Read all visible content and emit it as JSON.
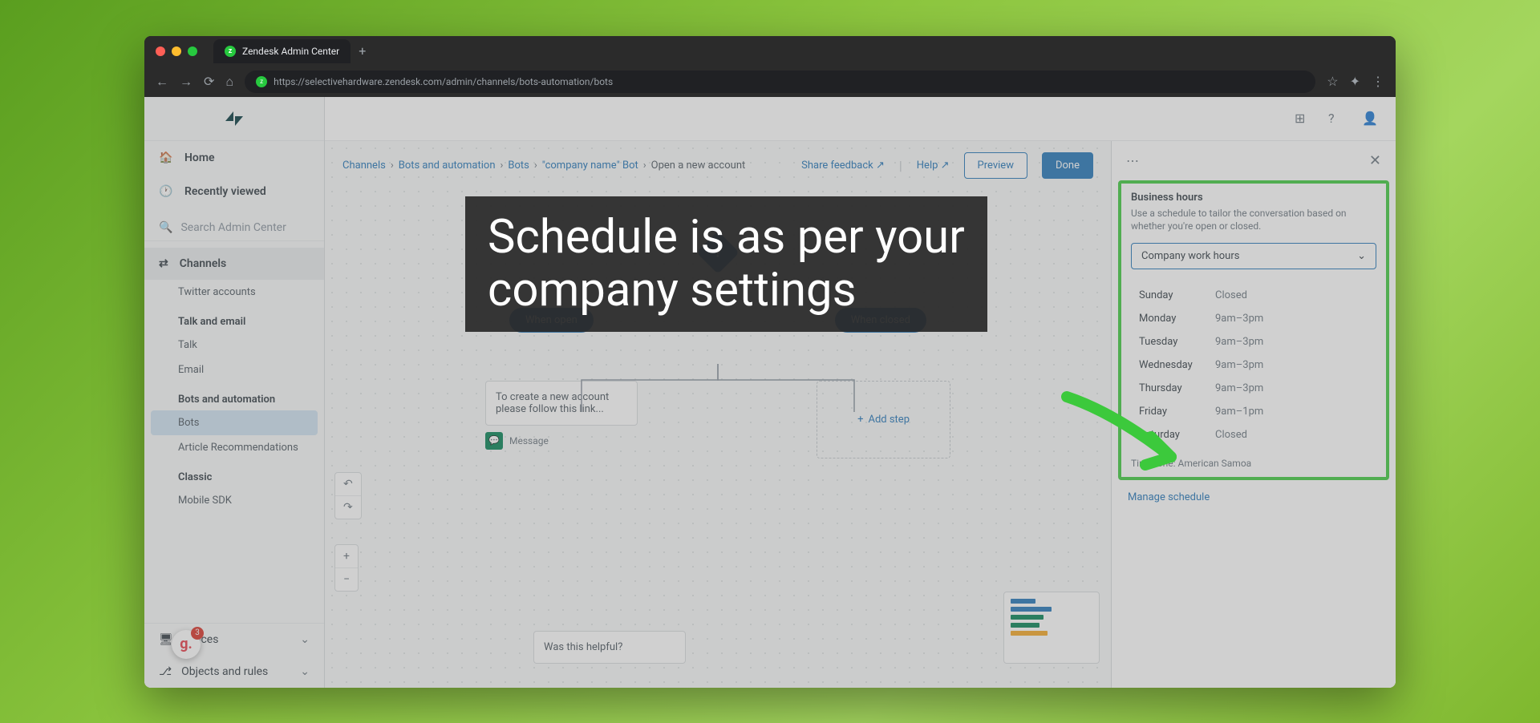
{
  "browser": {
    "tab_title": "Zendesk Admin Center",
    "url": "https://selectivehardware.zendesk.com/admin/channels/bots-automation/bots"
  },
  "sidebar": {
    "home": "Home",
    "recently": "Recently viewed",
    "search_placeholder": "Search Admin Center",
    "channels": "Channels",
    "twitter": "Twitter accounts",
    "talk_email_head": "Talk and email",
    "talk": "Talk",
    "email": "Email",
    "bots_head": "Bots and automation",
    "bots": "Bots",
    "article": "Article Recommendations",
    "classic_head": "Classic",
    "mobile": "Mobile SDK",
    "spaces": "spaces",
    "objects": "Objects and rules"
  },
  "header": {
    "breadcrumb": [
      "Channels",
      "Bots and automation",
      "Bots",
      "\"company name\" Bot",
      "Open a new account"
    ],
    "share": "Share feedback",
    "help": "Help",
    "preview": "Preview",
    "done": "Done"
  },
  "flow": {
    "when_open": "When open",
    "when_closed": "When closed",
    "create_text": "To create a new account please follow this link...",
    "message": "Message",
    "add_step": "Add step",
    "helpful": "Was this helpful?"
  },
  "panel": {
    "title": "Business hours",
    "desc": "Use a schedule to tailor the conversation based on whether you're open or closed.",
    "select": "Company work hours",
    "schedule": [
      {
        "day": "Sunday",
        "hours": "Closed"
      },
      {
        "day": "Monday",
        "hours": "9am–3pm"
      },
      {
        "day": "Tuesday",
        "hours": "9am–3pm"
      },
      {
        "day": "Wednesday",
        "hours": "9am–3pm"
      },
      {
        "day": "Thursday",
        "hours": "9am–3pm"
      },
      {
        "day": "Friday",
        "hours": "9am–1pm"
      },
      {
        "day": "Saturday",
        "hours": "Closed"
      }
    ],
    "timezone": "Timezone: American Samoa",
    "manage": "Manage schedule"
  },
  "overlay": {
    "line1": "Schedule is as per your",
    "line2": "company settings"
  },
  "badge_count": "3"
}
